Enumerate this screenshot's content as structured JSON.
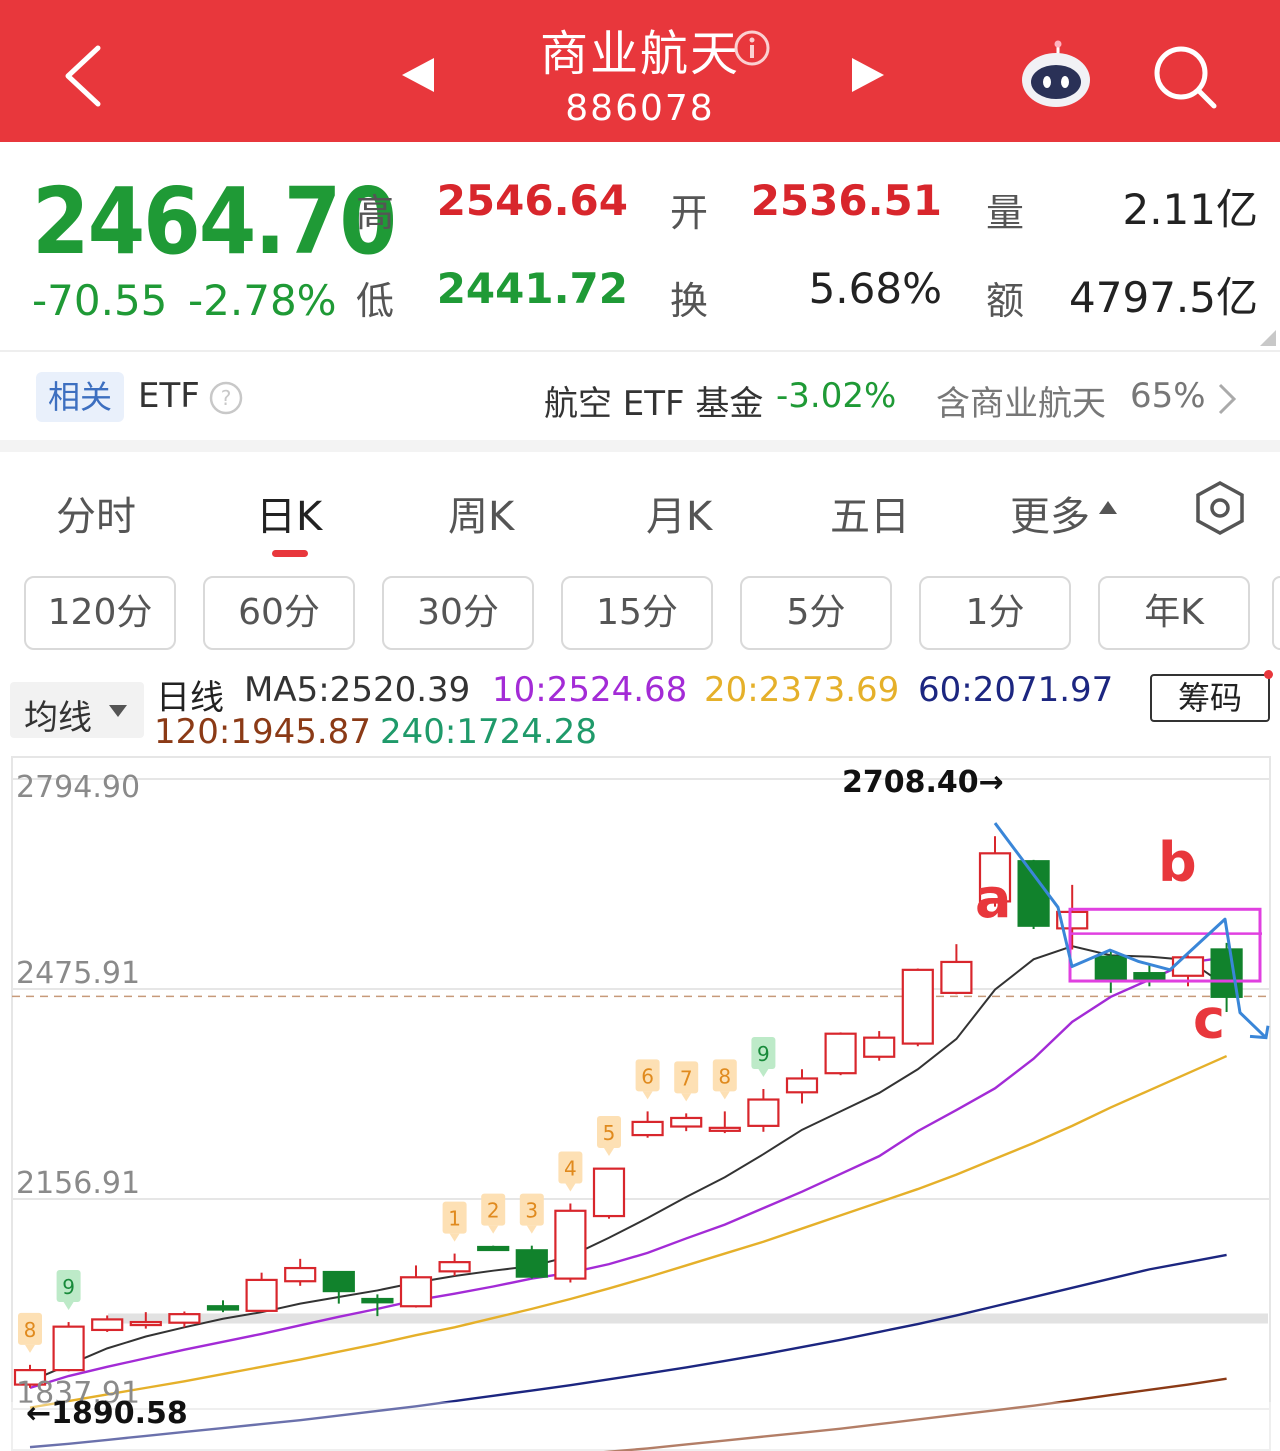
{
  "header": {
    "title": "商业航天",
    "code": "886078",
    "bg": "#e8373c"
  },
  "quote": {
    "price": "2464.70",
    "change": "-70.55",
    "change_pct": "-2.78%",
    "high_label": "高",
    "high": "2546.64",
    "low_label": "低",
    "low": "2441.72",
    "open_label": "开",
    "open": "2536.51",
    "turnover_label": "换",
    "turnover": "5.68%",
    "volume_label": "量",
    "volume": "2.11亿",
    "amount_label": "额",
    "amount": "4797.5亿"
  },
  "etf": {
    "tag": "相关",
    "label": "ETF",
    "name": "航空 ETF 基金",
    "change": "-3.02%",
    "contains": "含商业航天",
    "pct": "65%"
  },
  "tabs": [
    "分时",
    "日K",
    "周K",
    "月K",
    "五日",
    "更多"
  ],
  "active_tab": "日K",
  "periods": [
    "120分",
    "60分",
    "30分",
    "15分",
    "5分",
    "1分",
    "年K"
  ],
  "ma": {
    "selector": "均线",
    "label": "日线",
    "ma5": "MA5:2520.39",
    "ma10": "10:2524.68",
    "ma20": "20:2373.69",
    "ma60": "60:2071.97",
    "ma120": "120:1945.87",
    "ma240": "240:1724.28",
    "chip_button": "筹码"
  },
  "chart_data": {
    "type": "candlestick",
    "y_ticks": [
      "2794.90",
      "2475.91",
      "2156.91",
      "1837.91"
    ],
    "ylim": [
      1837.91,
      2794.9
    ],
    "current_price": 2464.7,
    "max_label": "2708.40→",
    "min_label": "←1890.58",
    "annotations": [
      "a",
      "b",
      "c"
    ],
    "seq_labels": [
      "8",
      "9",
      "1",
      "2",
      "3",
      "4",
      "5",
      "6",
      "7",
      "8",
      "9"
    ],
    "candles": [
      {
        "o": 1875,
        "c": 1897,
        "h": 1905,
        "l": 1870
      },
      {
        "o": 1897,
        "c": 1963,
        "h": 1970,
        "l": 1895
      },
      {
        "o": 1958,
        "c": 1974,
        "h": 1980,
        "l": 1955
      },
      {
        "o": 1966,
        "c": 1970,
        "h": 1985,
        "l": 1960
      },
      {
        "o": 1969,
        "c": 1982,
        "h": 1986,
        "l": 1962
      },
      {
        "o": 1994,
        "c": 1989,
        "h": 2003,
        "l": 1985
      },
      {
        "o": 1987,
        "c": 2034,
        "h": 2045,
        "l": 1985
      },
      {
        "o": 2032,
        "c": 2052,
        "h": 2066,
        "l": 2025
      },
      {
        "o": 2046,
        "c": 2017,
        "h": 2046,
        "l": 1998
      },
      {
        "o": 2005,
        "c": 2000,
        "h": 2012,
        "l": 1979
      },
      {
        "o": 1994,
        "c": 2038,
        "h": 2056,
        "l": 1992
      },
      {
        "o": 2047,
        "c": 2061,
        "h": 2074,
        "l": 2040
      },
      {
        "o": 2084,
        "c": 2080,
        "h": 2086,
        "l": 2078
      },
      {
        "o": 2079,
        "c": 2039,
        "h": 2086,
        "l": 2036
      },
      {
        "o": 2036,
        "c": 2139,
        "h": 2150,
        "l": 2030
      },
      {
        "o": 2131,
        "c": 2203,
        "h": 2204,
        "l": 2127
      },
      {
        "o": 2254,
        "c": 2274,
        "h": 2290,
        "l": 2250
      },
      {
        "o": 2267,
        "c": 2280,
        "h": 2287,
        "l": 2260
      },
      {
        "o": 2264,
        "c": 2265,
        "h": 2290,
        "l": 2257
      },
      {
        "o": 2268,
        "c": 2308,
        "h": 2324,
        "l": 2259
      },
      {
        "o": 2319,
        "c": 2340,
        "h": 2354,
        "l": 2302
      },
      {
        "o": 2348,
        "c": 2408,
        "h": 2410,
        "l": 2345
      },
      {
        "o": 2373,
        "c": 2402,
        "h": 2412,
        "l": 2367
      },
      {
        "o": 2393,
        "c": 2505,
        "h": 2507,
        "l": 2389
      },
      {
        "o": 2470,
        "c": 2517,
        "h": 2544,
        "l": 2468
      },
      {
        "o": 2609,
        "c": 2682,
        "h": 2708,
        "l": 2601
      },
      {
        "o": 2670,
        "c": 2572,
        "h": 2672,
        "l": 2567
      },
      {
        "o": 2568,
        "c": 2593,
        "h": 2634,
        "l": 2536
      },
      {
        "o": 2525,
        "c": 2490,
        "h": 2534,
        "l": 2470
      },
      {
        "o": 2500,
        "c": 2490,
        "h": 2512,
        "l": 2480
      },
      {
        "o": 2496,
        "c": 2524,
        "h": 2527,
        "l": 2480
      },
      {
        "o": 2536,
        "c": 2464,
        "h": 2546,
        "l": 2441
      }
    ],
    "ma5": [
      1880,
      1905,
      1930,
      1948,
      1962,
      1975,
      1985,
      1998,
      2008,
      2018,
      2030,
      2040,
      2048,
      2055,
      2070,
      2098,
      2128,
      2160,
      2190,
      2225,
      2262,
      2290,
      2318,
      2354,
      2400,
      2475,
      2521,
      2541,
      2527,
      2525,
      2520,
      2480
    ],
    "ma10": [
      1870,
      1888,
      1902,
      1915,
      1928,
      1940,
      1952,
      1965,
      1978,
      1990,
      2003,
      2013,
      2024,
      2036,
      2045,
      2058,
      2075,
      2097,
      2118,
      2143,
      2168,
      2195,
      2222,
      2260,
      2292,
      2325,
      2370,
      2426,
      2464,
      2490,
      2516,
      2524
    ],
    "ma20": [
      1840,
      1850,
      1860,
      1870,
      1880,
      1891,
      1902,
      1913,
      1925,
      1937,
      1950,
      1962,
      1976,
      1990,
      2005,
      2021,
      2038,
      2056,
      2074,
      2092,
      2112,
      2132,
      2152,
      2172,
      2194,
      2218,
      2242,
      2268,
      2296,
      2322,
      2348,
      2374
    ],
    "ma60": [
      1780,
      1785,
      1791,
      1797,
      1803,
      1809,
      1815,
      1821,
      1828,
      1835,
      1842,
      1850,
      1858,
      1866,
      1874,
      1883,
      1892,
      1901,
      1911,
      1921,
      1932,
      1943,
      1955,
      1967,
      1980,
      1994,
      2008,
      2022,
      2036,
      2050,
      2061,
      2072
    ],
    "ma120": [
      1706,
      1710,
      1714,
      1718,
      1722,
      1726,
      1730,
      1734,
      1738,
      1743,
      1748,
      1753,
      1758,
      1763,
      1768,
      1773,
      1778,
      1784,
      1790,
      1796,
      1802,
      1808,
      1815,
      1822,
      1829,
      1836,
      1843,
      1851,
      1859,
      1867,
      1875,
      1884
    ]
  },
  "colors": {
    "up": "#d8262c",
    "down": "#11822c",
    "ma5": "#333333",
    "ma10": "#a32bd6",
    "ma20": "#e5b02a",
    "ma60": "#1c2680",
    "ma120": "#8b3a16",
    "ma240": "#1f9a6a",
    "annotation": "#e8373c",
    "wave": "#3a86d8",
    "box": "#e040e0"
  }
}
